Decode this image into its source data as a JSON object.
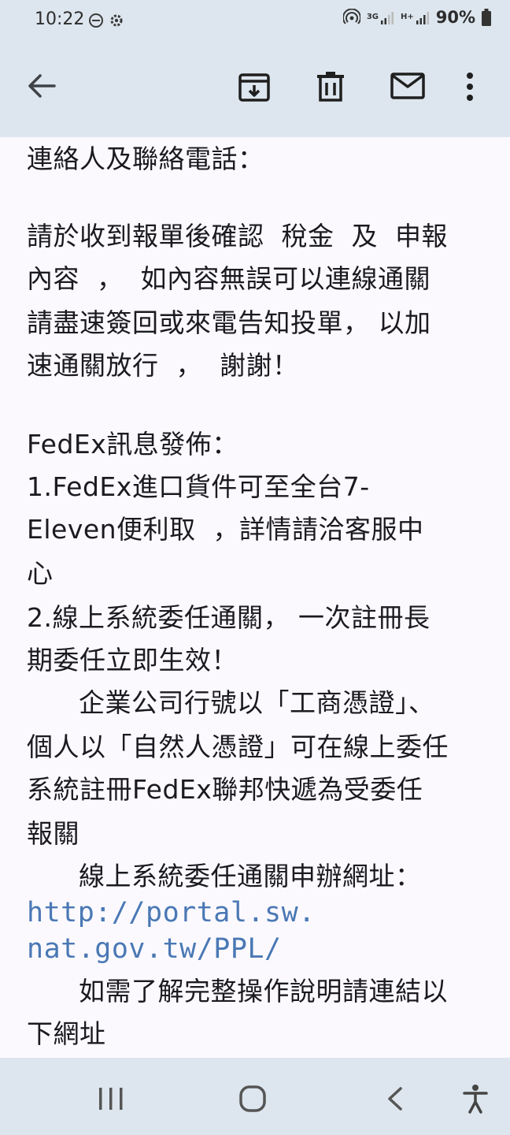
{
  "status_bar": {
    "time": "10:22",
    "net_1": "3G",
    "net_2": "H+",
    "battery": "90%"
  },
  "email_body": {
    "lines": [
      "連絡人及聯絡電話：",
      "請於收到報單後確認  稅金  及  申報",
      "內容  ，  如內容無誤可以連線通關",
      "請盡速簽回或來電告知投單， 以加",
      "速通關放行  ，  謝謝！",
      "FedEx訊息發佈：",
      "1.FedEx進口貨件可至全台7-",
      "Eleven便利取  ，詳情請洽客服中",
      "心",
      "2.線上系統委任通關， 一次註冊長",
      "期委任立即生效！",
      "      企業公司行號以「工商憑證」、",
      "個人以「自然人憑證」可在線上委任",
      "系統註冊FedEx聯邦快遞為受委任",
      "報關",
      "      線上系統委任通關申辦網址：",
      "http://portal.sw.",
      "nat.gov.tw/PPL/",
      "      如需了解完整操作說明請連結以",
      "下網址"
    ]
  },
  "icons": {
    "back": "arrow-left-icon",
    "archive": "archive-icon",
    "delete": "trash-icon",
    "mail": "mail-unread-icon",
    "more": "more-vert-icon",
    "nav_recents": "recents-icon",
    "nav_home": "home-icon",
    "nav_back": "nav-back-icon",
    "accessibility": "accessibility-icon"
  },
  "colors": {
    "bars": "#dde6ee",
    "content_bg": "#fbf9fe",
    "link": "#4a78b4",
    "text": "#1b1b1f"
  }
}
